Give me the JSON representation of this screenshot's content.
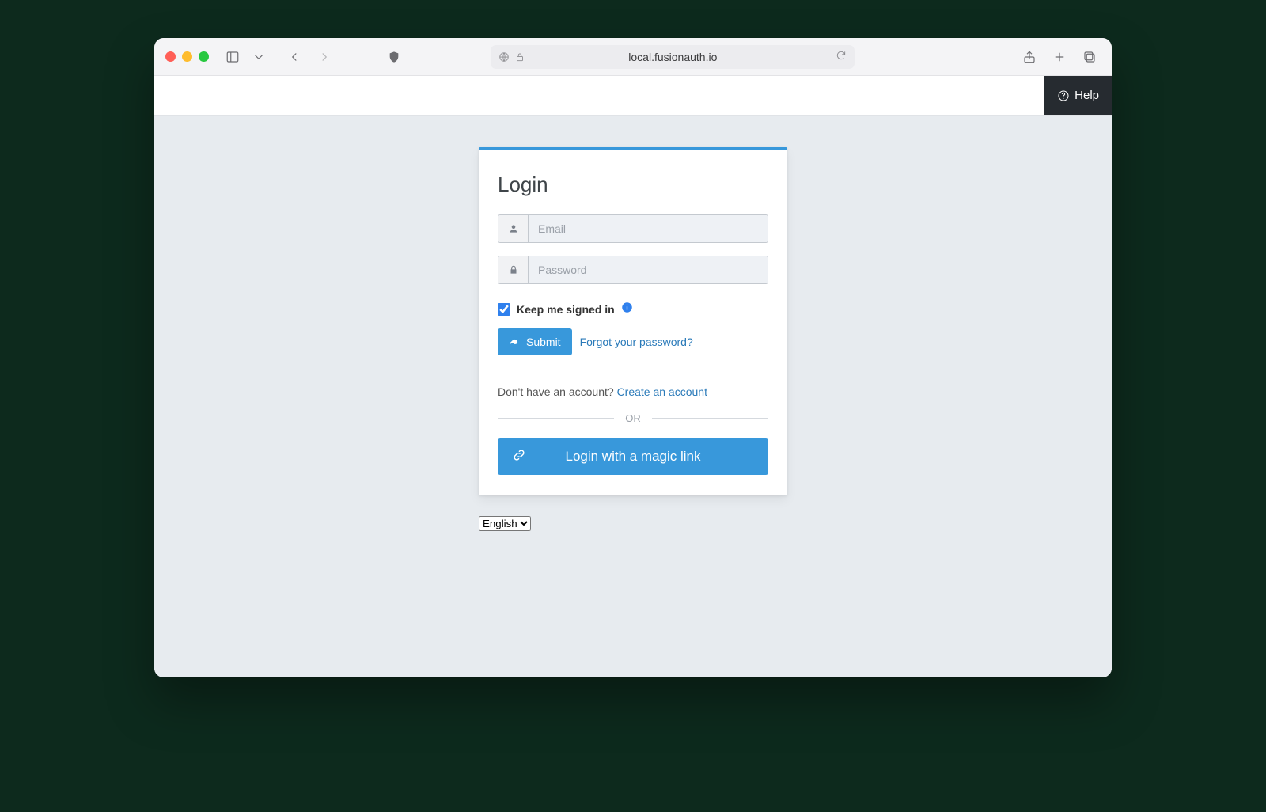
{
  "browser": {
    "address": "local.fusionauth.io"
  },
  "topnav": {
    "help_label": "Help"
  },
  "login": {
    "title": "Login",
    "email_placeholder": "Email",
    "email_value": "",
    "password_placeholder": "Password",
    "password_value": "",
    "keep_signed_label": "Keep me signed in",
    "keep_signed_checked": true,
    "submit_label": "Submit",
    "forgot_label": "Forgot your password?",
    "no_account_text": "Don't have an account? ",
    "create_account_label": "Create an account",
    "or_label": "OR",
    "magic_label": "Login with a magic link"
  },
  "language": {
    "selected": "English",
    "options": [
      "English"
    ]
  },
  "colors": {
    "accent": "#3898db",
    "page_bg": "#e7ebef",
    "topnav_bg": "#262b30"
  }
}
